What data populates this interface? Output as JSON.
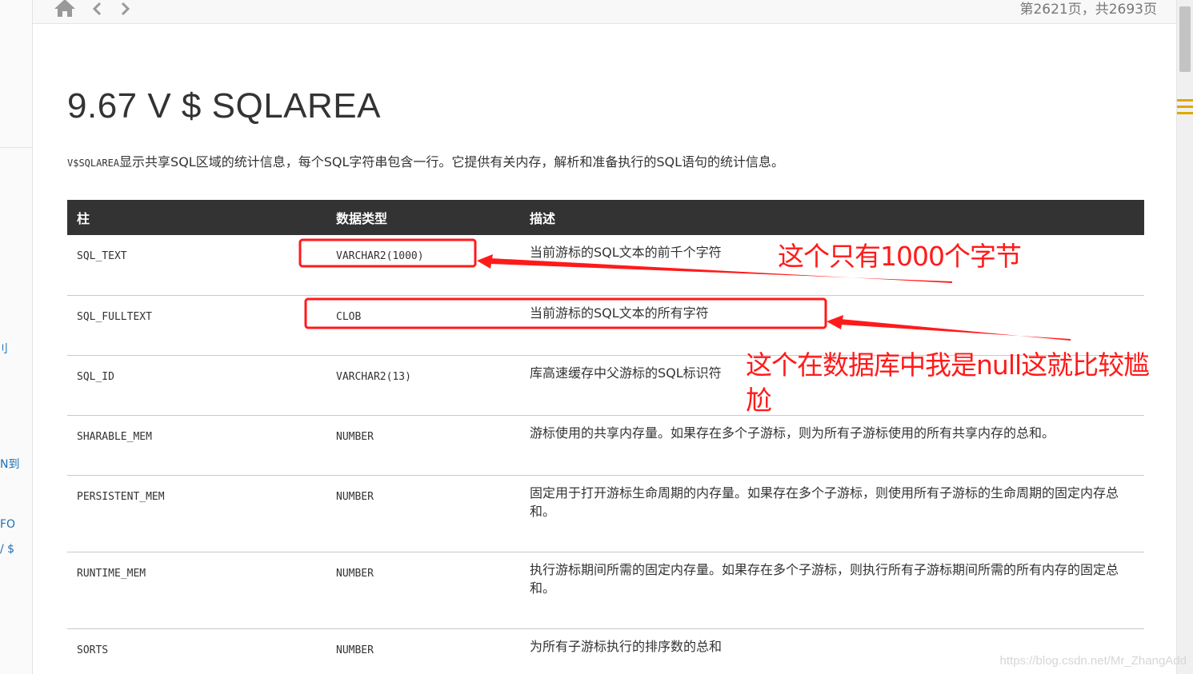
{
  "topbar": {
    "page_info": "第2621页，共2693页"
  },
  "left_rail": {
    "fragments": [
      "刂",
      "N到",
      "FO",
      "/ $"
    ]
  },
  "page": {
    "title": "9.67 V $ SQLAREA",
    "intro_code": "V$SQLAREA",
    "intro_text": "显示共享SQL区域的统计信息，每个SQL字符串包含一行。它提供有关内存，解析和准备执行的SQL语句的统计信息。"
  },
  "table": {
    "headers": [
      "柱",
      "数据类型",
      "描述"
    ],
    "rows": [
      {
        "column": "SQL_TEXT",
        "type": "VARCHAR2(1000)",
        "desc": "当前游标的SQL文本的前千个字符"
      },
      {
        "column": "SQL_FULLTEXT",
        "type": "CLOB",
        "desc": "当前游标的SQL文本的所有字符"
      },
      {
        "column": "SQL_ID",
        "type": "VARCHAR2(13)",
        "desc": "库高速缓存中父游标的SQL标识符"
      },
      {
        "column": "SHARABLE_MEM",
        "type": "NUMBER",
        "desc": "游标使用的共享内存量。如果存在多个子游标，则为所有子游标使用的所有共享内存的总和。"
      },
      {
        "column": "PERSISTENT_MEM",
        "type": "NUMBER",
        "desc": "固定用于打开游标生命周期的内存量。如果存在多个子游标，则使用所有子游标的生命周期的固定内存总和。"
      },
      {
        "column": "RUNTIME_MEM",
        "type": "NUMBER",
        "desc": "执行游标期间所需的固定内存量。如果存在多个子游标，则执行所有子游标期间所需的所有内存的固定总和。"
      },
      {
        "column": "SORTS",
        "type": "NUMBER",
        "desc": "为所有子游标执行的排序数的总和"
      }
    ]
  },
  "annotations": {
    "note1": "这个只有1000个字节",
    "note2_line1": "这个在数据库中我是null这就比较尴",
    "note2_line2": "尬",
    "color": "#ff1a1a"
  },
  "watermark": "https://blog.csdn.net/Mr_ZhangAdd",
  "colors": {
    "table_header_bg": "#333333",
    "annotation_red": "#ff1a1a"
  }
}
